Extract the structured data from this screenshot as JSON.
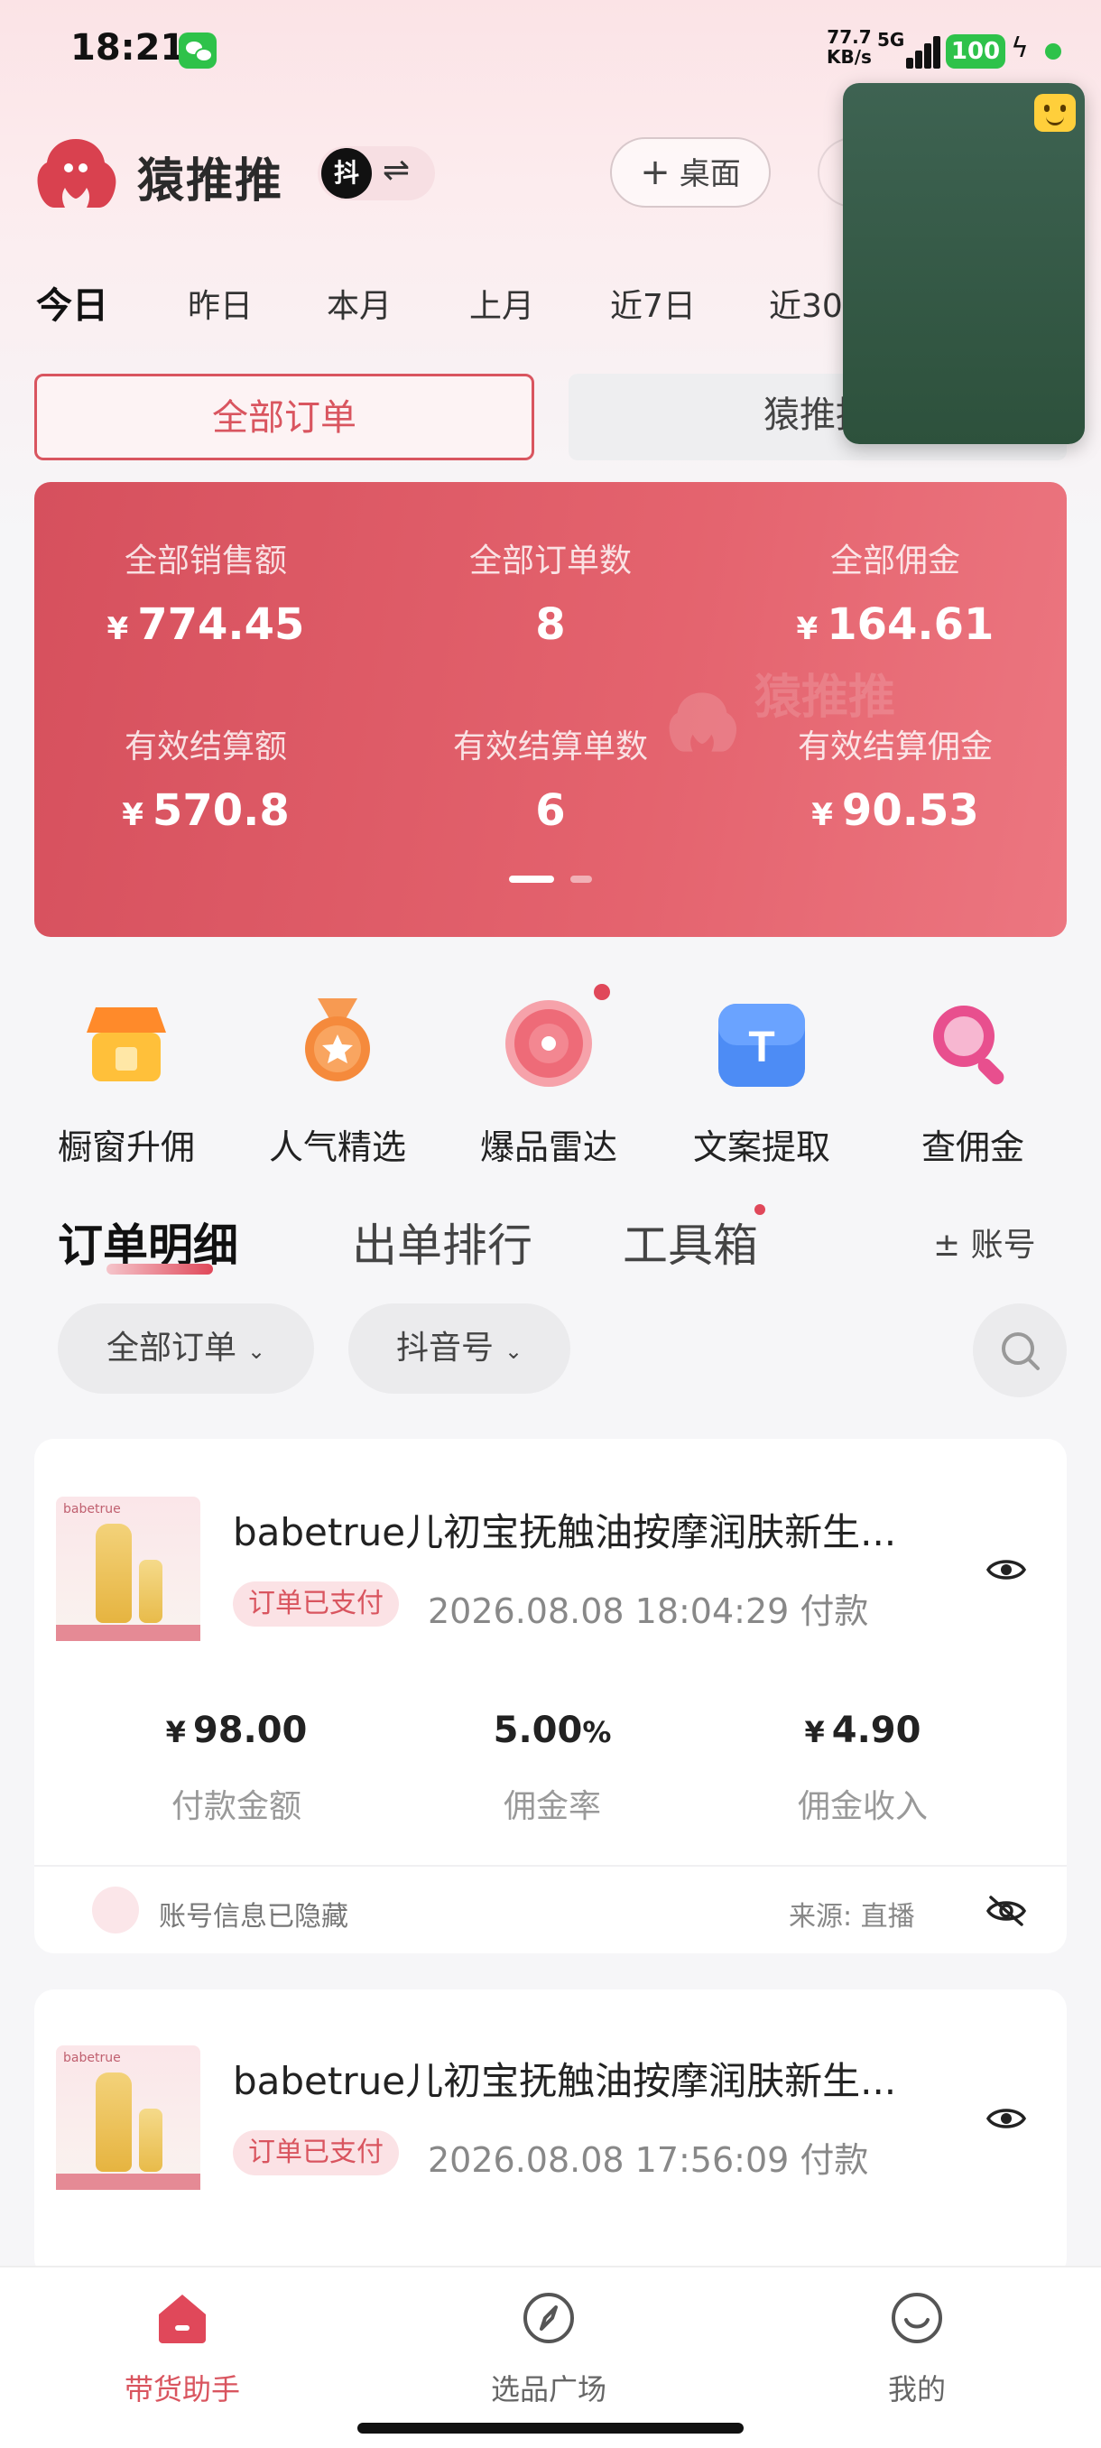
{
  "status_bar": {
    "time": "18:21",
    "net_speed_value": "77.7",
    "net_speed_unit": "KB/s",
    "network": "5G",
    "battery": "100"
  },
  "header": {
    "app_title": "猿推推",
    "douyin_badge": "抖",
    "desktop_button": "桌面"
  },
  "date_tabs": [
    "今日",
    "昨日",
    "本月",
    "上月",
    "近7日",
    "近30"
  ],
  "order_type_tabs": [
    "全部订单",
    "猿推推"
  ],
  "stats": {
    "watermark": "猿推推",
    "currency": "¥",
    "row1": [
      {
        "label": "全部销售额",
        "value": "774.45"
      },
      {
        "label": "全部订单数",
        "value": "8"
      },
      {
        "label": "全部佣金",
        "value": "164.61"
      }
    ],
    "row2": [
      {
        "label": "有效结算额",
        "value": "570.8"
      },
      {
        "label": "有效结算单数",
        "value": "6"
      },
      {
        "label": "有效结算佣金",
        "value": "90.53"
      }
    ]
  },
  "tools": [
    {
      "label": "橱窗升佣",
      "icon": "storefront-icon"
    },
    {
      "label": "人气精选",
      "icon": "medal-icon"
    },
    {
      "label": "爆品雷达",
      "icon": "radar-icon"
    },
    {
      "label": "文案提取",
      "icon": "text-extract-icon"
    },
    {
      "label": "查佣金",
      "icon": "magnifier-icon"
    }
  ],
  "section_tabs": [
    "订单明细",
    "出单排行",
    "工具箱"
  ],
  "account_link": "± 账号",
  "filters": [
    "全部订单",
    "抖音号"
  ],
  "orders": [
    {
      "brand": "babetrue",
      "title": "babetrue儿初宝抚触油按摩润肤新生...",
      "status": "订单已支付",
      "time": "2026.08.08 18:04:29 付款",
      "amount": "98.00",
      "rate": "5.00",
      "income": "4.90",
      "amount_label": "付款金额",
      "rate_label": "佣金率",
      "income_label": "佣金收入",
      "account_text": "账号信息已隐藏",
      "source_text": "来源: 直播"
    },
    {
      "brand": "babetrue",
      "title": "babetrue儿初宝抚触油按摩润肤新生...",
      "status": "订单已支付",
      "time": "2026.08.08 17:56:09 付款"
    }
  ],
  "bottom_nav": [
    {
      "label": "带货助手",
      "active": true
    },
    {
      "label": "选品广场",
      "active": false
    },
    {
      "label": "我的",
      "active": false
    }
  ],
  "colors": {
    "accent": "#d9555f",
    "card_gradient_start": "#d6505d",
    "card_gradient_end": "#ec7680"
  }
}
